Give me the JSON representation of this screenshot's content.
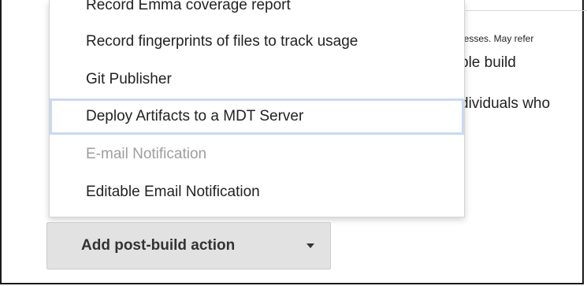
{
  "background": {
    "help_snippet": "lresses. May refer",
    "line1": "ble build",
    "line2": "dividuals who"
  },
  "menu": {
    "items": [
      {
        "label": "Record Emma coverage report",
        "state": "partially-visible"
      },
      {
        "label": "Record fingerprints of files to track usage",
        "state": "normal"
      },
      {
        "label": "Git Publisher",
        "state": "normal"
      },
      {
        "label": "Deploy Artifacts to a MDT Server",
        "state": "highlighted"
      },
      {
        "label": "E-mail Notification",
        "state": "disabled"
      },
      {
        "label": "Editable Email Notification",
        "state": "normal"
      }
    ]
  },
  "button": {
    "label": "Add post-build action",
    "icon": "caret-down-icon"
  },
  "colors": {
    "highlight_border": "#c8daf3",
    "disabled_text": "#9e9e9e",
    "button_bg": "#e2e2e2"
  }
}
